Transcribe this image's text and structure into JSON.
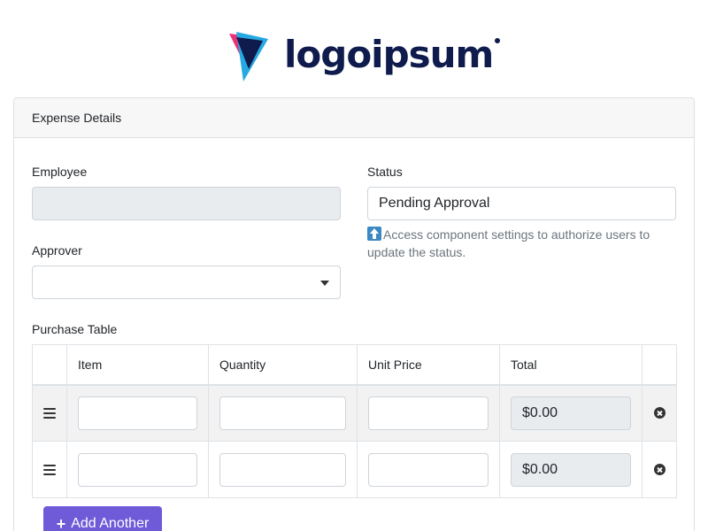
{
  "logo": {
    "text": "logoipsum",
    "colors": {
      "navy": "#0f1b4c",
      "pink": "#e9317a",
      "cyan": "#26a9e0"
    }
  },
  "panel": {
    "title": "Expense Details"
  },
  "employee": {
    "label": "Employee",
    "value": ""
  },
  "status": {
    "label": "Status",
    "value": "Pending Approval",
    "help_text": "Access component settings to authorize users to update the status.",
    "help_icon": "up-arrow-icon"
  },
  "approver": {
    "label": "Approver",
    "selected": ""
  },
  "purchase_table": {
    "label": "Purchase Table",
    "columns": [
      "Item",
      "Quantity",
      "Unit Price",
      "Total"
    ],
    "rows": [
      {
        "item": "",
        "quantity": "",
        "unit_price": "",
        "total": "$0.00"
      },
      {
        "item": "",
        "quantity": "",
        "unit_price": "",
        "total": "$0.00"
      }
    ],
    "add_label": "Add Another",
    "add_icon": "plus-icon",
    "drag_icon": "bars-icon",
    "remove_icon": "remove-circle-icon"
  },
  "colors": {
    "accent": "#6f5ad8",
    "disabled_bg": "#e9ecef",
    "help_text": "#6c757d"
  }
}
